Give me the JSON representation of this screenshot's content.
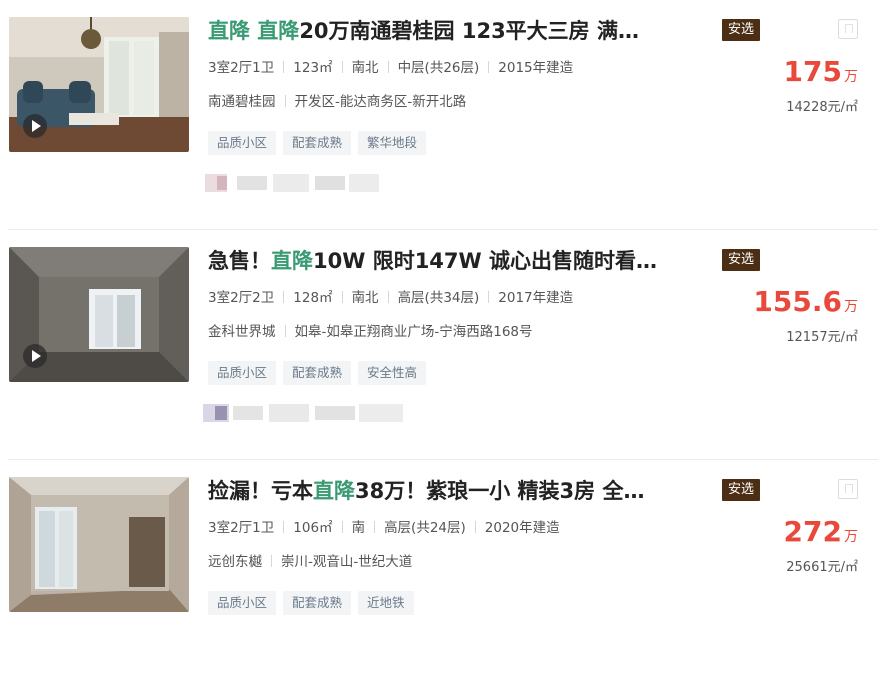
{
  "listings": [
    {
      "title_parts": [
        {
          "text": "直降 直降",
          "hl": true
        },
        {
          "text": "20万南通碧桂园 123平大三房 满…",
          "hl": false
        }
      ],
      "badge": "安选",
      "info": [
        "3室2厅1卫",
        "123㎡",
        "南北",
        "中层(共26层)",
        "2015年建造"
      ],
      "community": "南通碧桂园",
      "location": "开发区-能达商务区-新开北路",
      "tags": [
        "品质小区",
        "配套成熟",
        "繁华地段"
      ],
      "price": "175",
      "price_unit": "万",
      "unit_price": "14228元/㎡",
      "has_video": true,
      "photo": "living-room-blue-sofa"
    },
    {
      "title_parts": [
        {
          "text": "急售！",
          "hl": false
        },
        {
          "text": "直降",
          "hl": true
        },
        {
          "text": "10W 限时147W 诚心出售随时看…",
          "hl": false
        }
      ],
      "badge": "安选",
      "info": [
        "3室2厅2卫",
        "128㎡",
        "南北",
        "高层(共34层)",
        "2017年建造"
      ],
      "community": "金科世界城",
      "location": "如皋-如皋正翔商业广场-宁海西路168号",
      "tags": [
        "品质小区",
        "配套成熟",
        "安全性高"
      ],
      "price": "155.6",
      "price_unit": "万",
      "unit_price": "12157元/㎡",
      "has_video": true,
      "photo": "empty-concrete-room"
    },
    {
      "title_parts": [
        {
          "text": "捡漏！亏本",
          "hl": false
        },
        {
          "text": "直降",
          "hl": true
        },
        {
          "text": "38万！紫琅一小 精装3房 全…",
          "hl": false
        }
      ],
      "badge": "安选",
      "info": [
        "3室2厅1卫",
        "106㎡",
        "南",
        "高层(共24层)",
        "2020年建造"
      ],
      "community": "远创东樾",
      "location": "崇川-观音山-世纪大道",
      "tags": [
        "品质小区",
        "配套成熟",
        "近地铁"
      ],
      "price": "272",
      "price_unit": "万",
      "unit_price": "25661元/㎡",
      "has_video": false,
      "photo": "finished-empty-room"
    }
  ],
  "colors": {
    "highlight": "#3a9a73",
    "price": "#e8493a",
    "badge_bg": "#4b2e14",
    "tag_bg": "#f2f4f6",
    "tag_text": "#6a7a8a"
  }
}
